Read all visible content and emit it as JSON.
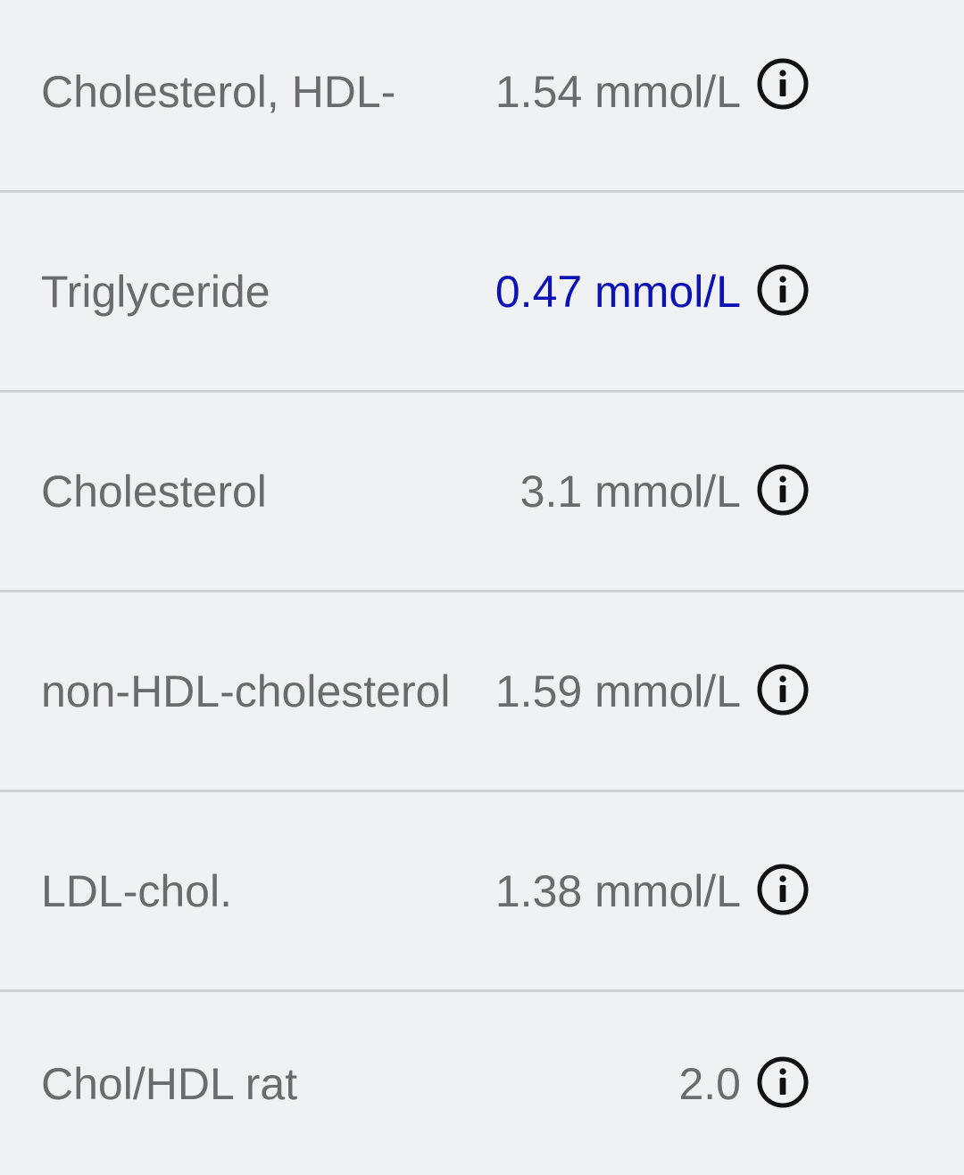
{
  "colors": {
    "background": "#f0f1f3",
    "divider": "#cfd0d3",
    "text": "#6b6b6b",
    "flagged_value": "#0d12b5",
    "icon": "#111111"
  },
  "results": [
    {
      "label": "Cholesterol, HDL-",
      "value": "1.54 mmol/L",
      "flagged": false,
      "icon": "info-icon"
    },
    {
      "label": "Triglyceride",
      "value": "0.47 mmol/L",
      "flagged": true,
      "icon": "info-icon"
    },
    {
      "label": "Cholesterol",
      "value": "3.1 mmol/L",
      "flagged": false,
      "icon": "info-icon"
    },
    {
      "label": "non-HDL-cholesterol",
      "value": "1.59 mmol/L",
      "flagged": false,
      "icon": "info-icon"
    },
    {
      "label": "LDL-chol.",
      "value": "1.38 mmol/L",
      "flagged": false,
      "icon": "info-icon"
    },
    {
      "label": "Chol/HDL rat",
      "value": "2.0",
      "flagged": false,
      "icon": "info-icon"
    }
  ]
}
